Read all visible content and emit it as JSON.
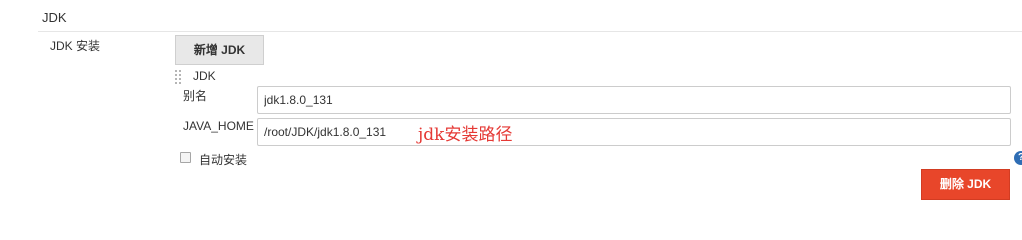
{
  "section": {
    "title": "JDK"
  },
  "jdk_row": {
    "label": "JDK 安装"
  },
  "add_button": {
    "label": "新增 JDK"
  },
  "item": {
    "header": "JDK",
    "alias_label": "别名",
    "alias_value": "jdk1.8.0_131",
    "java_home_label": "JAVA_HOME",
    "java_home_value": "/root/JDK/jdk1.8.0_131",
    "annotation": "jdk安装路径",
    "auto_install_label": "自动安装",
    "auto_install_checked": false,
    "help_icon_glyph": "?"
  },
  "delete_button": {
    "label": "删除 JDK"
  },
  "colors": {
    "accent_delete": "#e8462a",
    "annotation": "#e53935",
    "help_icon": "#2e6db4"
  },
  "icons": [
    "drag-handle-icon",
    "help-icon"
  ]
}
